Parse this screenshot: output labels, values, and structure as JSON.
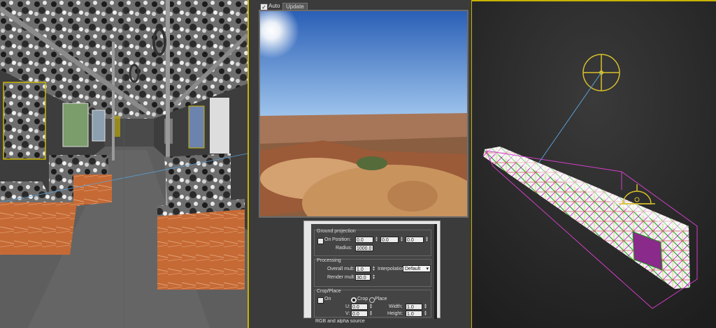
{
  "toolbar": {
    "auto_label": "Auto",
    "auto_checked": "✓",
    "update_label": "Update"
  },
  "ground_projection": {
    "title": "Ground projection",
    "on_label": "On",
    "position_label": "Position:",
    "position_values": [
      "0.0",
      "0.0",
      "0.0"
    ],
    "radius_label": "Radius:",
    "radius_value": "1000.0"
  },
  "processing": {
    "title": "Processing",
    "overall_mult_label": "Overall mult:",
    "overall_mult_value": "1.0",
    "render_mult_label": "Render mult:",
    "render_mult_value": "30.0",
    "interpolation_label": "Interpolation:",
    "interpolation_value": "Default"
  },
  "crop_place": {
    "title": "Crop/Place",
    "on_label": "On",
    "crop_label": "Crop",
    "place_label": "Place",
    "u_label": "U:",
    "u_value": "0.0",
    "v_label": "V:",
    "v_value": "0.0",
    "width_label": "Width:",
    "width_value": "1.0",
    "height_label": "Height:",
    "height_value": "1.0"
  },
  "next_section_title": "RGB and alpha source",
  "colors": {
    "selection_border": "#c9b400",
    "sky_top": "#2a5fb6",
    "sky_bottom": "#9ec4ec",
    "sand": "#c9935e"
  }
}
